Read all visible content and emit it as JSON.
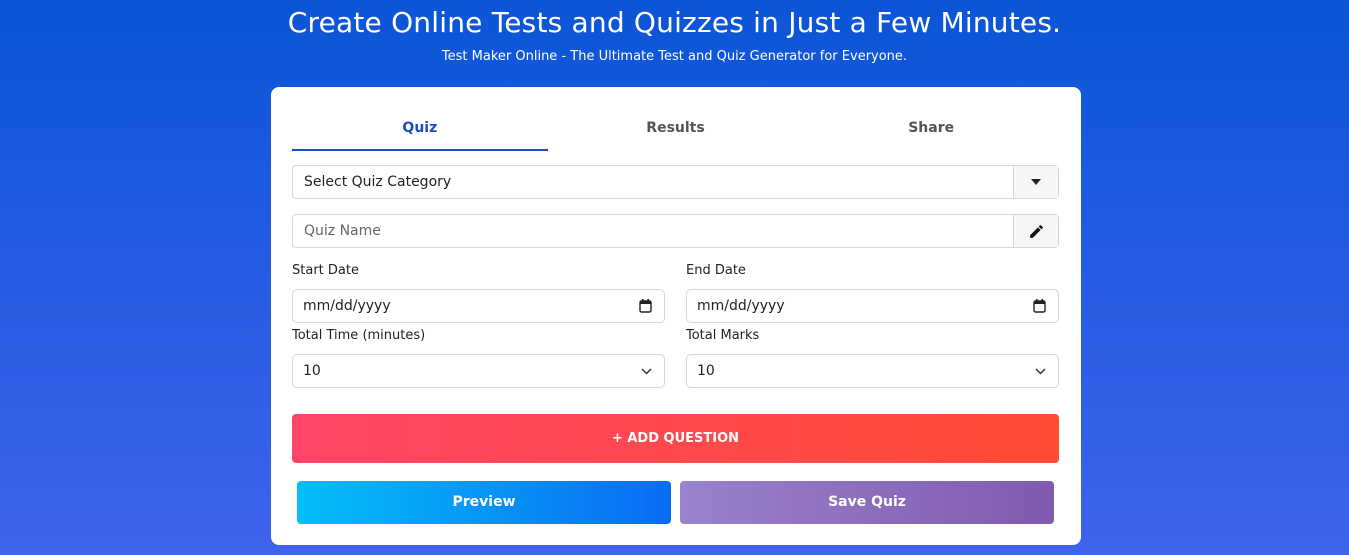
{
  "hero": {
    "title": "Create Online Tests and Quizzes in Just a Few Minutes.",
    "subtitle": "Test Maker Online - The Ultimate Test and Quiz Generator for Everyone."
  },
  "tabs": [
    {
      "label": "Quiz",
      "active": true
    },
    {
      "label": "Results",
      "active": false
    },
    {
      "label": "Share",
      "active": false
    }
  ],
  "form": {
    "category": {
      "value": "Select Quiz Category",
      "icon": "caret-down-icon"
    },
    "quiz_name": {
      "placeholder": "Quiz Name",
      "icon": "pencil-icon"
    },
    "start_date": {
      "label": "Start Date",
      "value": "mm/dd/yyyy",
      "icon": "calendar-icon"
    },
    "end_date": {
      "label": "End Date",
      "value": "mm/dd/yyyy",
      "icon": "calendar-icon"
    },
    "total_time": {
      "label": "Total Time (minutes)",
      "value": "10",
      "icon": "chevron-down-icon"
    },
    "total_marks": {
      "label": "Total Marks",
      "value": "10",
      "icon": "chevron-down-icon"
    }
  },
  "buttons": {
    "add_question": "+ ADD QUESTION",
    "preview": "Preview",
    "save_quiz": "Save Quiz"
  },
  "colors": {
    "background_top": "#0b55d6",
    "background_bottom": "#3f63ec",
    "tab_active": "#1a4fc4",
    "add_question_start": "#ff4667",
    "add_question_end": "#ff4b33",
    "preview_start": "#05bff8",
    "preview_end": "#0a6bf3",
    "save_start": "#9a82cc",
    "save_end": "#7f5ab0"
  }
}
